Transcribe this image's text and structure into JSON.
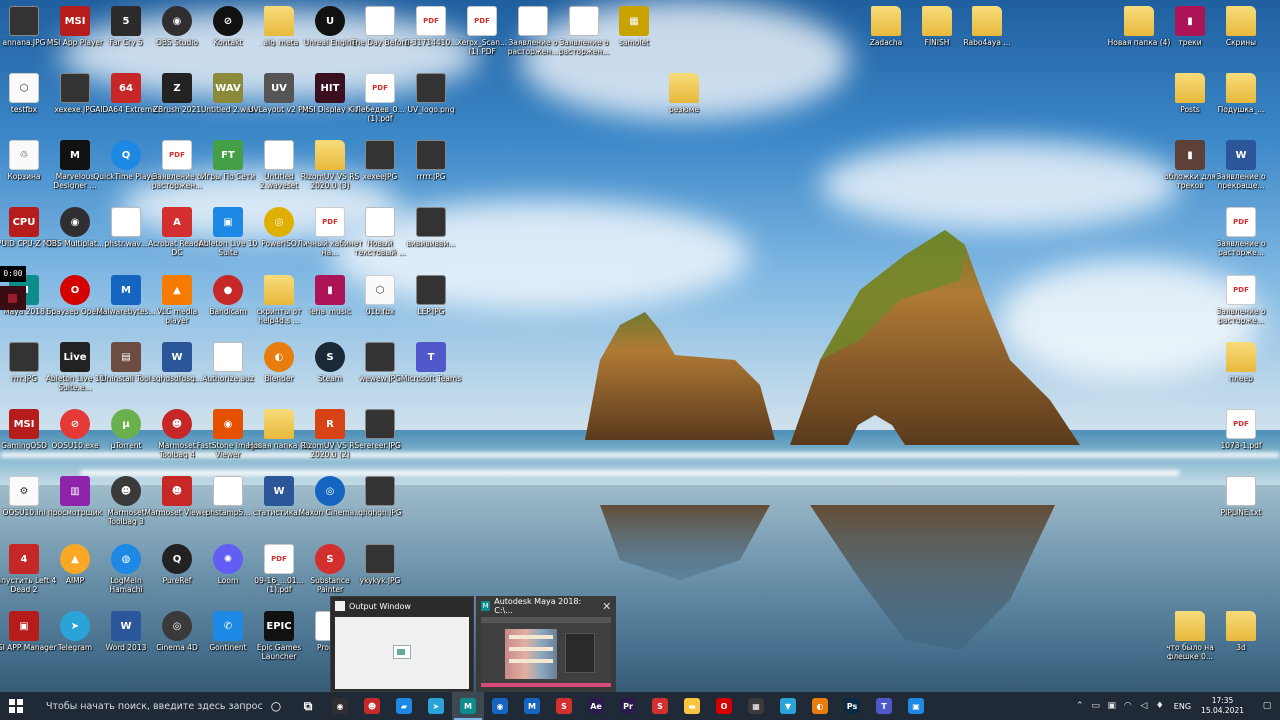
{
  "desktop": {
    "icons": [
      {
        "label": "annana.JPG",
        "kind": "img",
        "glyph": ""
      },
      {
        "label": "MSI App Player",
        "kind": "app",
        "glyph": "MSI",
        "color": "#b71c1c"
      },
      {
        "label": "Far Cry 5",
        "kind": "app",
        "glyph": "5",
        "color": "#2b2b2b"
      },
      {
        "label": "OBS Studio",
        "kind": "round",
        "glyph": "◉",
        "color": "#302e31"
      },
      {
        "label": "Kontakt",
        "kind": "round",
        "glyph": "⊘",
        "color": "#111111"
      },
      {
        "label": "_alg_meta",
        "kind": "folder",
        "glyph": ""
      },
      {
        "label": "Unreal Engine",
        "kind": "round",
        "glyph": "U",
        "color": "#111111"
      },
      {
        "label": "The Day Before",
        "kind": "doc",
        "glyph": ""
      },
      {
        "label": "fl-31714410...",
        "kind": "pdf",
        "glyph": "PDF"
      },
      {
        "label": "Xerox_Scan... (1).PDF",
        "kind": "pdf",
        "glyph": "PDF"
      },
      {
        "label": "Заявление о расторжен...",
        "kind": "doc",
        "glyph": ""
      },
      {
        "label": "Заявление о расторжен...",
        "kind": "doc",
        "glyph": ""
      },
      {
        "label": "samolet",
        "kind": "app",
        "glyph": "▦",
        "color": "#c8a200"
      },
      {
        "label": "testfbx",
        "kind": "white",
        "glyph": "⬡"
      },
      {
        "label": "xexexe.JPG",
        "kind": "img",
        "glyph": ""
      },
      {
        "label": "AIDA64 Extreme",
        "kind": "app",
        "glyph": "64",
        "color": "#c62828"
      },
      {
        "label": "ZBrush 2021",
        "kind": "app",
        "glyph": "Z",
        "color": "#222222"
      },
      {
        "label": "Untitled 2.wav",
        "kind": "app",
        "glyph": "WAV",
        "color": "#8a8a3a"
      },
      {
        "label": "UVLayout v2 Pro",
        "kind": "app",
        "glyph": "UV",
        "color": "#555555"
      },
      {
        "label": "MSI Display Kit",
        "kind": "app",
        "glyph": "HIT",
        "color": "#3a1020"
      },
      {
        "label": "Лебедев_0... (1).pdf",
        "kind": "pdf",
        "glyph": "PDF"
      },
      {
        "label": "UV_logo.png",
        "kind": "img",
        "glyph": ""
      },
      {
        "label": "Корзина",
        "kind": "white",
        "glyph": "♲"
      },
      {
        "label": "Marvelous Designer ...",
        "kind": "app",
        "glyph": "M",
        "color": "#111111"
      },
      {
        "label": "QuickTime Player",
        "kind": "round",
        "glyph": "Q",
        "color": "#1e88e5"
      },
      {
        "label": "Заявление о расторжен...",
        "kind": "pdf",
        "glyph": "PDF"
      },
      {
        "label": "Игры По Сети",
        "kind": "app",
        "glyph": "FT",
        "color": "#43a047"
      },
      {
        "label": "Untitled 2.waveset",
        "kind": "doc",
        "glyph": ""
      },
      {
        "label": "RizomUV VS RS 2020.0 (3)",
        "kind": "folder",
        "glyph": ""
      },
      {
        "label": "xexeeJPG",
        "kind": "img",
        "glyph": ""
      },
      {
        "label": "rrrrr.JPG",
        "kind": "img",
        "glyph": ""
      },
      {
        "label": "CPUID CPU-Z MSI",
        "kind": "app",
        "glyph": "CPU",
        "color": "#b71c1c"
      },
      {
        "label": "OBS Multiplat...",
        "kind": "round",
        "glyph": "◉",
        "color": "#302e31"
      },
      {
        "label": "phstr.wav...",
        "kind": "doc",
        "glyph": ""
      },
      {
        "label": "Acrobat Reader DC",
        "kind": "app",
        "glyph": "A",
        "color": "#d32f2f"
      },
      {
        "label": "Ableton Live 10 Suite",
        "kind": "app",
        "glyph": "▣",
        "color": "#1e88e5"
      },
      {
        "label": "PowerISO",
        "kind": "round",
        "glyph": "◎",
        "color": "#e0b000"
      },
      {
        "label": "Личный кабинет на...",
        "kind": "pdf",
        "glyph": "PDF"
      },
      {
        "label": "Новый текстовый ...",
        "kind": "doc",
        "glyph": ""
      },
      {
        "label": "вивививви...",
        "kind": "img",
        "glyph": ""
      },
      {
        "label": "Maya 2018",
        "kind": "app",
        "glyph": "M",
        "color": "#0e8c8c"
      },
      {
        "label": "Браузер Opera",
        "kind": "round",
        "glyph": "O",
        "color": "#d50000"
      },
      {
        "label": "Malwarebytes...",
        "kind": "app",
        "glyph": "M",
        "color": "#1565c0"
      },
      {
        "label": "VLC media player",
        "kind": "app",
        "glyph": "▲",
        "color": "#f57c00"
      },
      {
        "label": "Bandicam",
        "kind": "round",
        "glyph": "●",
        "color": "#c62828"
      },
      {
        "label": "скрипты от help4d.s ...",
        "kind": "folder",
        "glyph": ""
      },
      {
        "label": "leha_music",
        "kind": "app",
        "glyph": "▮",
        "color": "#ad1457"
      },
      {
        "label": "01b.fbx",
        "kind": "white",
        "glyph": "⬡"
      },
      {
        "label": "LEP.JPG",
        "kind": "img",
        "glyph": ""
      },
      {
        "label": "rrrr.JPG",
        "kind": "img",
        "glyph": ""
      },
      {
        "label": "Ableton Live 10 Suite.e...",
        "kind": "app",
        "glyph": "Live",
        "color": "#222222"
      },
      {
        "label": "Uninstall Tool",
        "kind": "app",
        "glyph": "▤",
        "color": "#6d4c41"
      },
      {
        "label": "sghdsdfdsg...",
        "kind": "word",
        "glyph": "W"
      },
      {
        "label": "Authorize.auz",
        "kind": "doc",
        "glyph": ""
      },
      {
        "label": "Blender",
        "kind": "round",
        "glyph": "◐",
        "color": "#e87d0d"
      },
      {
        "label": "Steam",
        "kind": "round",
        "glyph": "S",
        "color": "#1b2838"
      },
      {
        "label": "wewew.JPG",
        "kind": "img",
        "glyph": ""
      },
      {
        "label": "Microsoft Teams",
        "kind": "app",
        "glyph": "T",
        "color": "#5059c9"
      },
      {
        "label": "GamingOSD",
        "kind": "app",
        "glyph": "MSI",
        "color": "#b71c1c"
      },
      {
        "label": "OOSU10.exe",
        "kind": "round",
        "glyph": "⊘",
        "color": "#e53935"
      },
      {
        "label": "μTorrent",
        "kind": "round",
        "glyph": "μ",
        "color": "#6ab04c"
      },
      {
        "label": "Marmoset Toolbag 4",
        "kind": "round",
        "glyph": "☻",
        "color": "#c62828"
      },
      {
        "label": "FastStone Image Viewer",
        "kind": "app",
        "glyph": "◉",
        "color": "#e65100"
      },
      {
        "label": "Новая папка (2)",
        "kind": "folder",
        "glyph": ""
      },
      {
        "label": "RizomUV VS RS 2020.0 (2)",
        "kind": "app",
        "glyph": "R",
        "color": "#d84315"
      },
      {
        "label": "erereer.JPG",
        "kind": "img",
        "glyph": ""
      },
      {
        "label": "OOSU10.ini",
        "kind": "white",
        "glyph": "⚙"
      },
      {
        "label": "просмотрщик",
        "kind": "app",
        "glyph": "▥",
        "color": "#8e24aa"
      },
      {
        "label": "Marmoset Toolbag 3",
        "kind": "round",
        "glyph": "☻",
        "color": "#3a3a3a"
      },
      {
        "label": "Marmoset Viewer",
        "kind": "app",
        "glyph": "☻",
        "color": "#c62828"
      },
      {
        "label": "phstamp5...",
        "kind": "doc",
        "glyph": ""
      },
      {
        "label": "статистика...",
        "kind": "word",
        "glyph": "W"
      },
      {
        "label": "Maxon Cinema...",
        "kind": "round",
        "glyph": "◎",
        "color": "#1565c0"
      },
      {
        "label": "ghghgh.JPG",
        "kind": "img",
        "glyph": ""
      },
      {
        "label": "Запустить Left 4 Dead 2",
        "kind": "app",
        "glyph": "4",
        "color": "#c62828"
      },
      {
        "label": "AIMP",
        "kind": "round",
        "glyph": "▲",
        "color": "#f9a825"
      },
      {
        "label": "LogMeIn Hamachi",
        "kind": "round",
        "glyph": "◍",
        "color": "#1e88e5"
      },
      {
        "label": "PureRef",
        "kind": "round",
        "glyph": "Q",
        "color": "#222222"
      },
      {
        "label": "Loom",
        "kind": "round",
        "glyph": "✺",
        "color": "#625df5"
      },
      {
        "label": "09-16_...01... (1).pdf",
        "kind": "pdf",
        "glyph": "PDF"
      },
      {
        "label": "Substance Painter",
        "kind": "round",
        "glyph": "S",
        "color": "#d32f2f"
      },
      {
        "label": "ykykyk.JPG",
        "kind": "img",
        "glyph": ""
      },
      {
        "label": "MSI APP Manager",
        "kind": "app",
        "glyph": "▣",
        "color": "#b71c1c"
      },
      {
        "label": "Telegram",
        "kind": "round",
        "glyph": "➤",
        "color": "#2aa3d9"
      },
      {
        "label": "Word 2013",
        "kind": "word",
        "glyph": "W"
      },
      {
        "label": "Cinema 4D",
        "kind": "round",
        "glyph": "◎",
        "color": "#3a3a3a"
      },
      {
        "label": "Gontinent",
        "kind": "app",
        "glyph": "✆",
        "color": "#1e88e5"
      },
      {
        "label": "Epic Games Launcher",
        "kind": "app",
        "glyph": "EPIC",
        "color": "#111111"
      },
      {
        "label": "Propl...",
        "kind": "doc",
        "glyph": ""
      },
      {
        "label": "Zadacha",
        "kind": "folder",
        "glyph": ""
      },
      {
        "label": "FINISH",
        "kind": "folder",
        "glyph": ""
      },
      {
        "label": "Rabo4aya ...",
        "kind": "folder",
        "glyph": ""
      },
      {
        "label": "резюме",
        "kind": "folder",
        "glyph": ""
      },
      {
        "label": "Новая папка (4)",
        "kind": "folder",
        "glyph": ""
      },
      {
        "label": "треки",
        "kind": "app",
        "glyph": "▮",
        "color": "#ad1457"
      },
      {
        "label": "Скрины",
        "kind": "folder",
        "glyph": ""
      },
      {
        "label": "Posts",
        "kind": "folder",
        "glyph": ""
      },
      {
        "label": "Подушка_...",
        "kind": "folder",
        "glyph": ""
      },
      {
        "label": "обложки для треков",
        "kind": "app",
        "glyph": "▮",
        "color": "#5d4037"
      },
      {
        "label": "Заявление о прекраще...",
        "kind": "word",
        "glyph": "W"
      },
      {
        "label": "Заявление о расторже...",
        "kind": "pdf",
        "glyph": "PDF"
      },
      {
        "label": "Заявление о расторже...",
        "kind": "pdf",
        "glyph": "PDF"
      },
      {
        "label": "плеер",
        "kind": "folder",
        "glyph": ""
      },
      {
        "label": "1073-1.pdf",
        "kind": "pdf",
        "glyph": "PDF"
      },
      {
        "label": "PIPLINE.txt",
        "kind": "doc",
        "glyph": ""
      },
      {
        "label": "что было на флешке 0...",
        "kind": "folder",
        "glyph": ""
      },
      {
        "label": "3d",
        "kind": "folder",
        "glyph": ""
      }
    ]
  },
  "recording": {
    "time": "0:00"
  },
  "previews": [
    {
      "title": "Output Window",
      "icon": "output-window-icon"
    },
    {
      "title": "Autodesk Maya 2018: C:\\...",
      "icon": "maya-icon"
    }
  ],
  "taskbar": {
    "search_placeholder": "Чтобы начать поиск, введите здесь запрос",
    "apps": [
      {
        "name": "cortana",
        "glyph": "○",
        "color": "transparent"
      },
      {
        "name": "task-view",
        "glyph": "⧉",
        "color": "transparent"
      },
      {
        "name": "obs",
        "glyph": "◉",
        "color": "#302e31"
      },
      {
        "name": "bandicam",
        "glyph": "☻",
        "color": "#c62828"
      },
      {
        "name": "explorer-blue",
        "glyph": "▰",
        "color": "#1e88e5"
      },
      {
        "name": "telegram",
        "glyph": "➤",
        "color": "#2aa3d9"
      },
      {
        "name": "maya",
        "glyph": "M",
        "color": "#0e8c8c",
        "active": true
      },
      {
        "name": "chrome",
        "glyph": "◉",
        "color": "#1565c0"
      },
      {
        "name": "malwarebytes",
        "glyph": "M",
        "color": "#1565c0"
      },
      {
        "name": "substance",
        "glyph": "S",
        "color": "#d32f2f"
      },
      {
        "name": "after-effects",
        "glyph": "Ae",
        "color": "#2b1a4d"
      },
      {
        "name": "premiere",
        "glyph": "Pr",
        "color": "#2b1a4d"
      },
      {
        "name": "substance-painter",
        "glyph": "S",
        "color": "#d32f2f"
      },
      {
        "name": "file-explorer",
        "glyph": "▬",
        "color": "#f9c440"
      },
      {
        "name": "opera",
        "glyph": "O",
        "color": "#d50000"
      },
      {
        "name": "calculator",
        "glyph": "▦",
        "color": "#3a3a3a"
      },
      {
        "name": "shield",
        "glyph": "▼",
        "color": "#2aa3d9"
      },
      {
        "name": "blender",
        "glyph": "◐",
        "color": "#e87d0d"
      },
      {
        "name": "photoshop",
        "glyph": "Ps",
        "color": "#0b2942"
      },
      {
        "name": "teams",
        "glyph": "T",
        "color": "#5059c9"
      },
      {
        "name": "app-blue",
        "glyph": "▣",
        "color": "#1e88e5"
      }
    ],
    "tray": {
      "lang": "ENG",
      "time": "17:35",
      "date": "15.04.2021"
    }
  }
}
